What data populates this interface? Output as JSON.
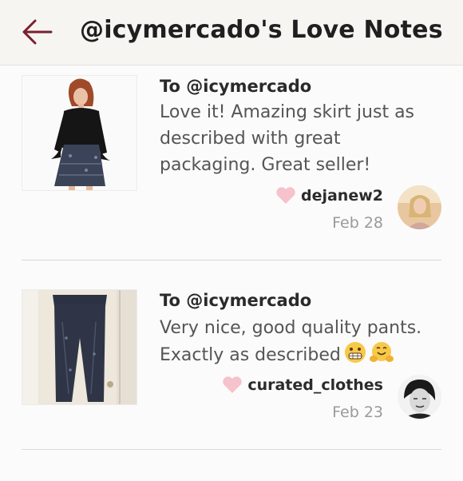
{
  "header": {
    "title": "@icymercado's Love Notes",
    "back_icon": "back-arrow-icon"
  },
  "colors": {
    "accent": "#7a1f2e",
    "heart": "#f6c2cb",
    "body_text": "#555555",
    "date_text": "#9a9a9a"
  },
  "notes": [
    {
      "recipient": "To @icymercado",
      "message": "Love it! Amazing skirt just as\ndescribed with great\npackaging. Great seller!",
      "username": "dejanew2",
      "date": "Feb 28",
      "heart_icon": "heart-icon"
    },
    {
      "recipient": "To @icymercado",
      "message": "Very nice, good quality pants.\nExactly as described",
      "emojis": [
        "grimacing-face",
        "hugging-face"
      ],
      "username": "curated_clothes",
      "date": "Feb 23",
      "heart_icon": "heart-icon"
    }
  ]
}
